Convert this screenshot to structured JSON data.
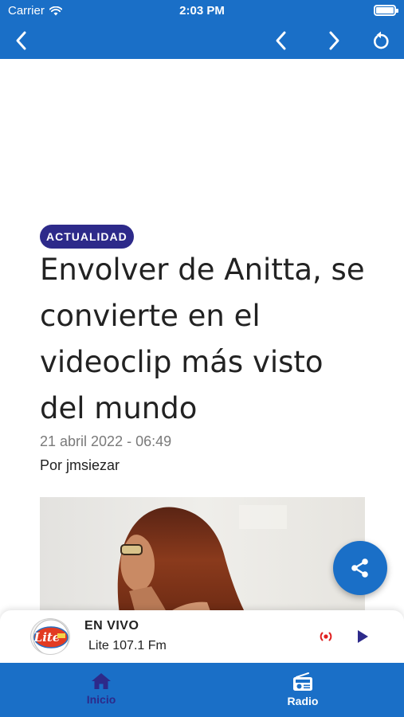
{
  "status_bar": {
    "carrier": "Carrier",
    "time": "2:03 PM"
  },
  "nav": {
    "back_icon": "chevron-left-icon",
    "prev_icon": "chevron-left-icon",
    "next_icon": "chevron-right-icon",
    "reload_icon": "reload-icon"
  },
  "article": {
    "category": "ACTUALIDAD",
    "title": "Envolver de Anitta, se convierte en el videoclip más visto del mundo",
    "date": "21 abril 2022 - 06:49",
    "author": "Por jmsiezar"
  },
  "player": {
    "live_label": "EN VIVO",
    "station_name": "Lite 107.1 Fm",
    "logo_text": "Lite"
  },
  "tabs": [
    {
      "label": "Inicio",
      "icon": "home-icon",
      "active": true
    },
    {
      "label": "Radio",
      "icon": "radio-icon",
      "active": false
    }
  ],
  "colors": {
    "primary": "#1a6fc7",
    "accent": "#2d2a8a",
    "live_red": "#e02020"
  }
}
